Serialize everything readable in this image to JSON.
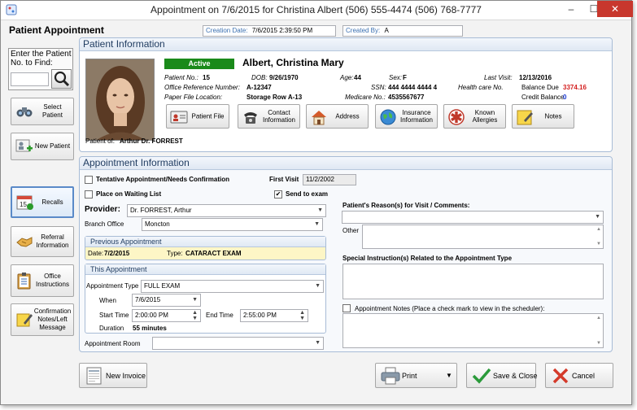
{
  "window": {
    "title": "Appointment on 7/6/2015 for Christina Albert  (506) 555-4474  (506) 768-7777",
    "minimize": "–",
    "maximize": "☐",
    "close": "✕"
  },
  "header": {
    "heading": "Patient Appointment",
    "creation_date_label": "Creation Date:",
    "creation_date": "7/6/2015 2:39:50 PM",
    "created_by_label": "Created By:",
    "created_by": "A"
  },
  "finder": {
    "label": "Enter the Patient No. to Find:",
    "value": ""
  },
  "sidebar": {
    "select_patient": "Select Patient",
    "new_patient": "New Patient",
    "recalls": "Recalls",
    "referral_information": "Referral Information",
    "office_instructions": "Office Instructions",
    "confirmation_notes": "Confirmation Notes/Left Message"
  },
  "patient_info": {
    "section_title": "Patient Information",
    "status": "Active",
    "name": "Albert, Christina Mary",
    "patient_no_label": "Patient No.:",
    "patient_no": "15",
    "dob_label": "DOB:",
    "dob": "9/26/1970",
    "age_label": "Age:",
    "age": "44",
    "sex_label": "Sex:",
    "sex": "F",
    "last_visit_label": "Last Visit:",
    "last_visit": "12/13/2016",
    "office_ref_label": "Office Reference Number:",
    "office_ref": "A-12347",
    "ssn_label": "SSN:",
    "ssn": "444 4444 4444 4",
    "health_care_label": "Health care No.",
    "balance_due_label": "Balance Due",
    "balance_due": "3374.16",
    "paper_file_label": "Paper File Location:",
    "paper_file": "Storage Row A-13",
    "medicare_label": "Medicare No.:",
    "medicare": "4535567677",
    "credit_balance_label": "Credit Balance",
    "credit_balance": "0",
    "patient_of_label": "Patient of:",
    "patient_of": "Arthur Dr. FORREST",
    "colors": {
      "active_badge": "#1a8a1a",
      "balance_due": "#d42020",
      "credit_balance": "#1a3ad4"
    }
  },
  "actions": {
    "patient_file": "Patient File",
    "contact_information": "Contact Information",
    "address": "Address",
    "insurance_information": "Insurance Information",
    "known_allergies": "Known Allergies",
    "notes": "Notes"
  },
  "appointment": {
    "section_title": "Appointment Information",
    "tentative_label": "Tentative Appointment/Needs Confirmation",
    "tentative_checked": false,
    "first_visit_label": "First Visit",
    "first_visit": "11/2/2002",
    "waiting_list_label": "Place on Waiting List",
    "waiting_list_checked": false,
    "send_to_exam_label": "Send to exam",
    "send_to_exam_checked": true,
    "provider_label": "Provider:",
    "provider": "Dr. FORREST, Arthur",
    "branch_label": "Branch Office",
    "branch": "Moncton",
    "previous": {
      "title": "Previous Appointment",
      "date_label": "Date:",
      "date": "7/2/2015",
      "type_label": "Type:",
      "type": "CATARACT EXAM"
    },
    "this": {
      "title": "This Appointment",
      "type_label": "Appointment Type",
      "type": "FULL EXAM",
      "when_label": "When",
      "when": "7/6/2015",
      "start_label": "Start Time",
      "start": "2:00:00 PM",
      "end_label": "End Time",
      "end": "2:55:00 PM",
      "duration_label": "Duration",
      "duration": "55 minutes"
    },
    "room_label": "Appointment Room",
    "room": "",
    "reason_label": "Patient's Reason(s) for Visit / Comments:",
    "reason": "",
    "other_label": "Other",
    "special_label": "Special Instruction(s) Related to the Appointment Type",
    "notes_label": "Appointment Notes (Place a check mark to view in the scheduler):",
    "notes_checked": false
  },
  "footer": {
    "new_invoice": "New Invoice",
    "print": "Print",
    "save_close": "Save & Close",
    "cancel": "Cancel"
  }
}
